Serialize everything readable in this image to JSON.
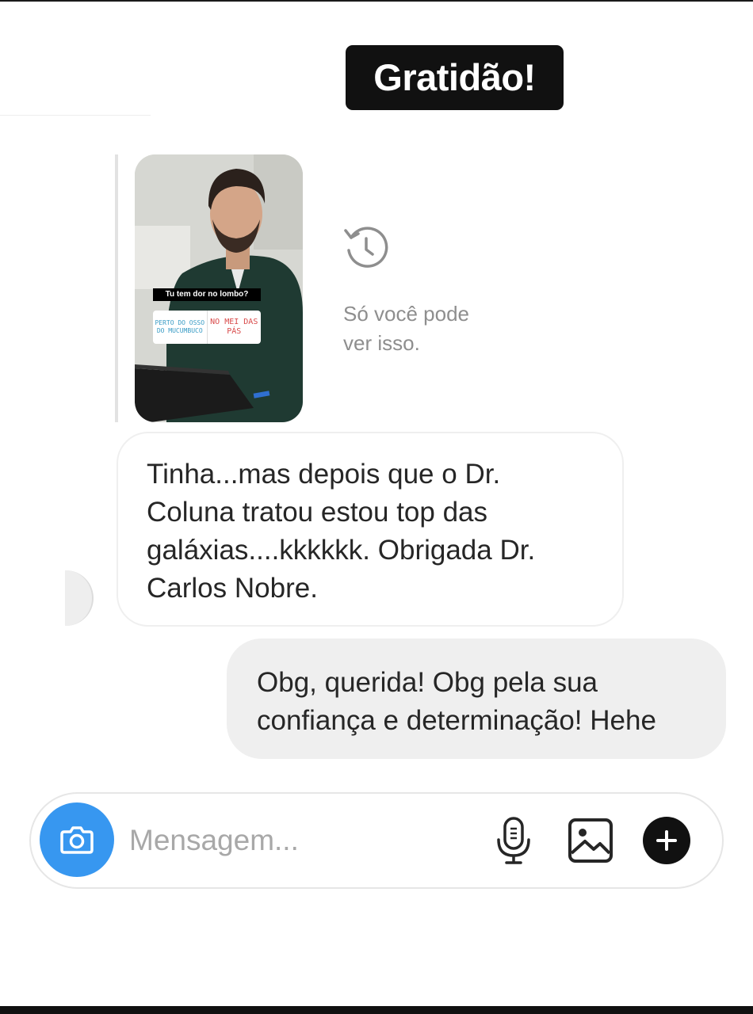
{
  "sticker": {
    "title": "Gratidão!"
  },
  "story_reply": {
    "poll_question": "Tu tem dor no lombo?",
    "poll_option_a": "PERTO DO OSSO DO MUCUMBUCO",
    "poll_option_b": "NO MEI DAS PÁS",
    "visibility_note_line1": "Só você pode",
    "visibility_note_line2": "ver isso.",
    "icon": "history-icon"
  },
  "messages": [
    {
      "direction": "incoming",
      "lines": [
        "Tinha...mas depois que o Dr.",
        "Coluna tratou estou top das",
        "galáxias....kkkkkk. Obrigada  Dr.",
        "Carlos Nobre."
      ]
    },
    {
      "direction": "outgoing",
      "lines": [
        "Obg, querida! Obg pela sua",
        "confiança e determinação! Hehe"
      ]
    }
  ],
  "composer": {
    "placeholder": "Mensagem...",
    "value": "",
    "icons": [
      "camera-icon",
      "microphone-icon",
      "gallery-icon",
      "plus-icon"
    ]
  },
  "colors": {
    "accent": "#3797f0",
    "incoming_bubble": "#ffffff",
    "outgoing_bubble": "#efefef",
    "muted_text": "#8e8e8e"
  }
}
